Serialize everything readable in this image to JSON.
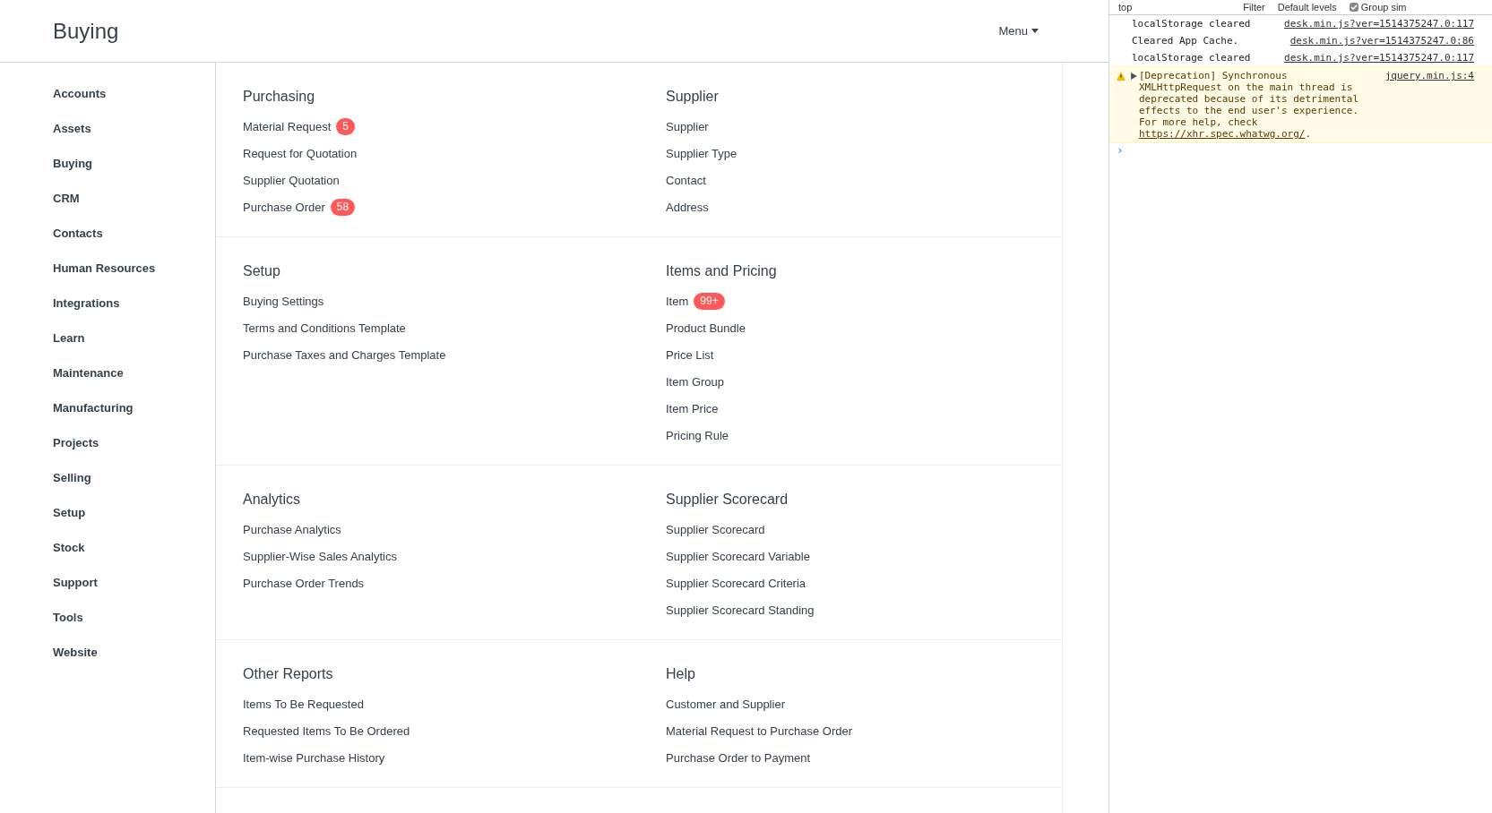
{
  "header": {
    "title": "Buying",
    "menu": "Menu"
  },
  "sidebar": {
    "items": [
      "Accounts",
      "Assets",
      "Buying",
      "CRM",
      "Contacts",
      "Human Resources",
      "Integrations",
      "Learn",
      "Maintenance",
      "Manufacturing",
      "Projects",
      "Selling",
      "Setup",
      "Stock",
      "Support",
      "Tools",
      "Website"
    ]
  },
  "sections": [
    {
      "columns": [
        {
          "title": "Purchasing",
          "links": [
            {
              "label": "Material Request",
              "count": "5"
            },
            {
              "label": "Request for Quotation"
            },
            {
              "label": "Supplier Quotation"
            },
            {
              "label": "Purchase Order",
              "count": "58"
            }
          ]
        },
        {
          "title": "Supplier",
          "links": [
            {
              "label": "Supplier"
            },
            {
              "label": "Supplier Type"
            },
            {
              "label": "Contact"
            },
            {
              "label": "Address"
            }
          ]
        }
      ]
    },
    {
      "columns": [
        {
          "title": "Setup",
          "links": [
            {
              "label": "Buying Settings"
            },
            {
              "label": "Terms and Conditions Template"
            },
            {
              "label": "Purchase Taxes and Charges Template"
            }
          ]
        },
        {
          "title": "Items and Pricing",
          "links": [
            {
              "label": "Item",
              "count": "99+"
            },
            {
              "label": "Product Bundle"
            },
            {
              "label": "Price List"
            },
            {
              "label": "Item Group"
            },
            {
              "label": "Item Price"
            },
            {
              "label": "Pricing Rule"
            }
          ]
        }
      ]
    },
    {
      "columns": [
        {
          "title": "Analytics",
          "links": [
            {
              "label": "Purchase Analytics"
            },
            {
              "label": "Supplier-Wise Sales Analytics"
            },
            {
              "label": "Purchase Order Trends"
            }
          ]
        },
        {
          "title": "Supplier Scorecard",
          "links": [
            {
              "label": "Supplier Scorecard"
            },
            {
              "label": "Supplier Scorecard Variable"
            },
            {
              "label": "Supplier Scorecard Criteria"
            },
            {
              "label": "Supplier Scorecard Standing"
            }
          ]
        }
      ]
    },
    {
      "columns": [
        {
          "title": "Other Reports",
          "links": [
            {
              "label": "Items To Be Requested"
            },
            {
              "label": "Requested Items To Be Ordered"
            },
            {
              "label": "Item-wise Purchase History"
            }
          ]
        },
        {
          "title": "Help",
          "links": [
            {
              "label": "Customer and Supplier"
            },
            {
              "label": "Material Request to Purchase Order"
            },
            {
              "label": "Purchase Order to Payment"
            }
          ]
        }
      ]
    }
  ],
  "console": {
    "toolbar": {
      "context": "top",
      "filter_placeholder": "Filter",
      "levels": "Default levels",
      "group_label": "Group sim",
      "group_checked": true
    },
    "messages": [
      {
        "kind": "log",
        "text": "localStorage cleared",
        "source": "desk.min.js?ver=1514375247.0:117"
      },
      {
        "kind": "log",
        "text": "Cleared App Cache.",
        "source": "desk.min.js?ver=1514375247.0:86"
      },
      {
        "kind": "log",
        "text": "localStorage cleared",
        "source": "desk.min.js?ver=1514375247.0:117"
      },
      {
        "kind": "warning",
        "text": "[Deprecation] Synchronous XMLHttpRequest on the main thread is deprecated because of its detrimental effects to the end user's experience. For more help, check ",
        "link": "https://xhr.spec.whatwg.org/",
        "tail": ".",
        "source": "jquery.min.js:4"
      }
    ],
    "prompt": "›"
  }
}
